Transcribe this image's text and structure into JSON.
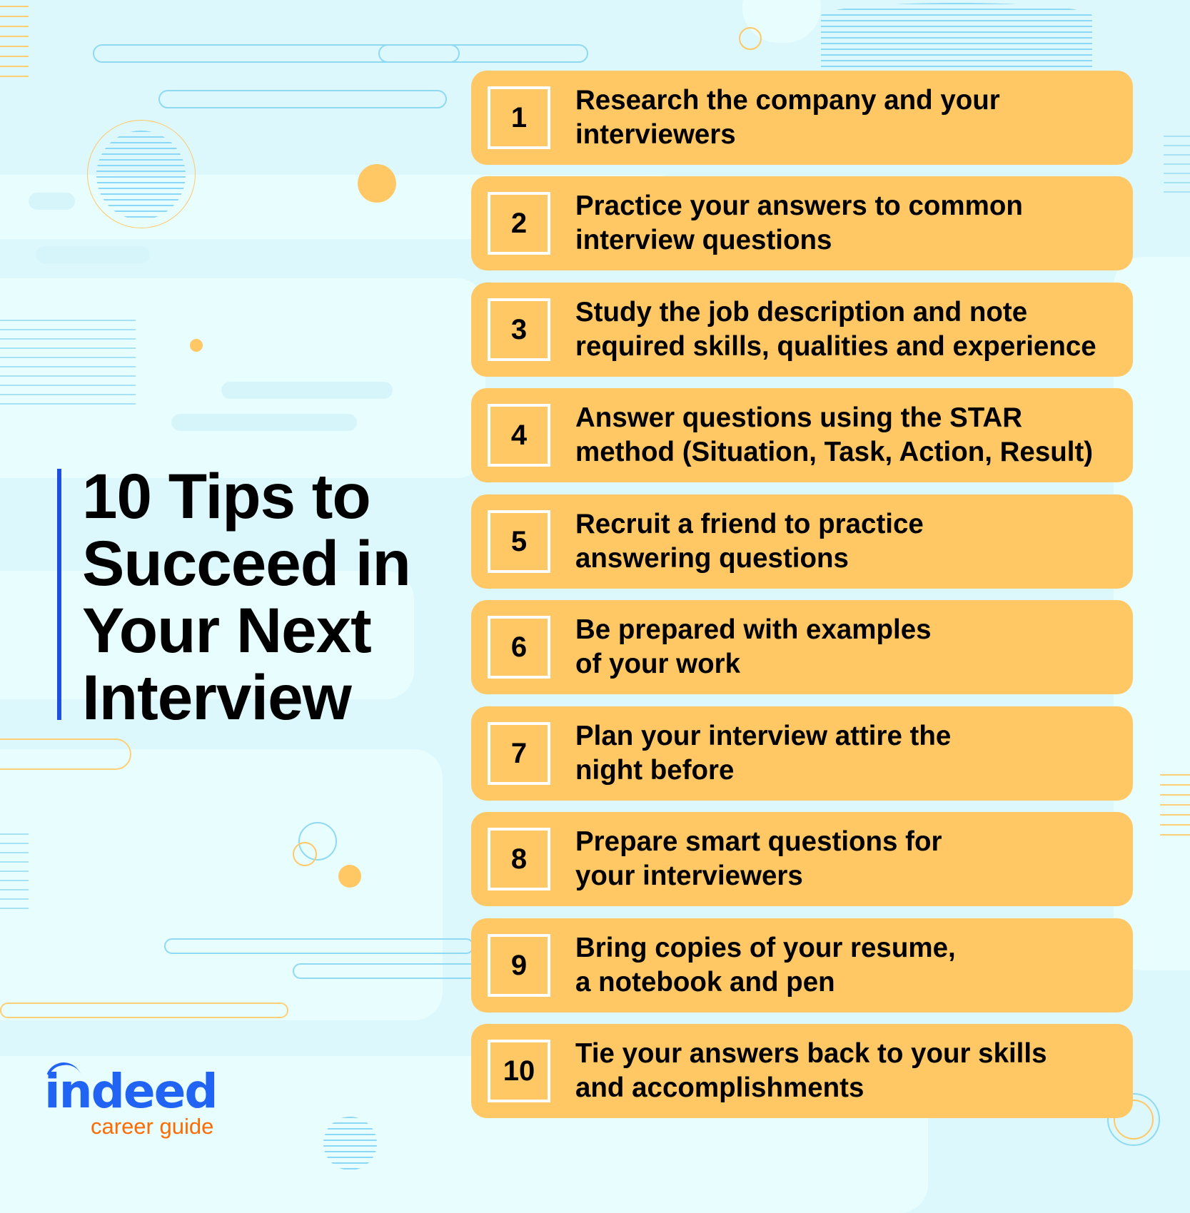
{
  "title": "10 Tips to Succeed in Your Next Interview",
  "title_lines": [
    "10 Tips to",
    "Succeed in",
    "Your Next",
    "Interview"
  ],
  "tips": [
    {
      "number": "1",
      "text": "Research the company and your\ninterviewers"
    },
    {
      "number": "2",
      "text": "Practice your answers to common\ninterview questions"
    },
    {
      "number": "3",
      "text": "Study the job description and note\nrequired skills, qualities and experience"
    },
    {
      "number": "4",
      "text": "Answer questions using the STAR\nmethod (Situation, Task, Action, Result)"
    },
    {
      "number": "5",
      "text": "Recruit a friend to practice\nanswering questions"
    },
    {
      "number": "6",
      "text": "Be prepared with examples\nof your work"
    },
    {
      "number": "7",
      "text": "Plan your interview attire the\nnight before"
    },
    {
      "number": "8",
      "text": "Prepare smart questions for\nyour interviewers"
    },
    {
      "number": "9",
      "text": "Bring copies of your resume,\na notebook and pen"
    },
    {
      "number": "10",
      "text": "Tie your answers back to your skills\nand accomplishments"
    }
  ],
  "logo": {
    "brand": "indeed",
    "subtitle": "career guide"
  },
  "colors": {
    "background": "#dcf8fd",
    "card": "#ffc865",
    "accent_bar": "#1e4fe0",
    "logo_blue": "#2164f3",
    "logo_orange": "#ff6b00"
  }
}
